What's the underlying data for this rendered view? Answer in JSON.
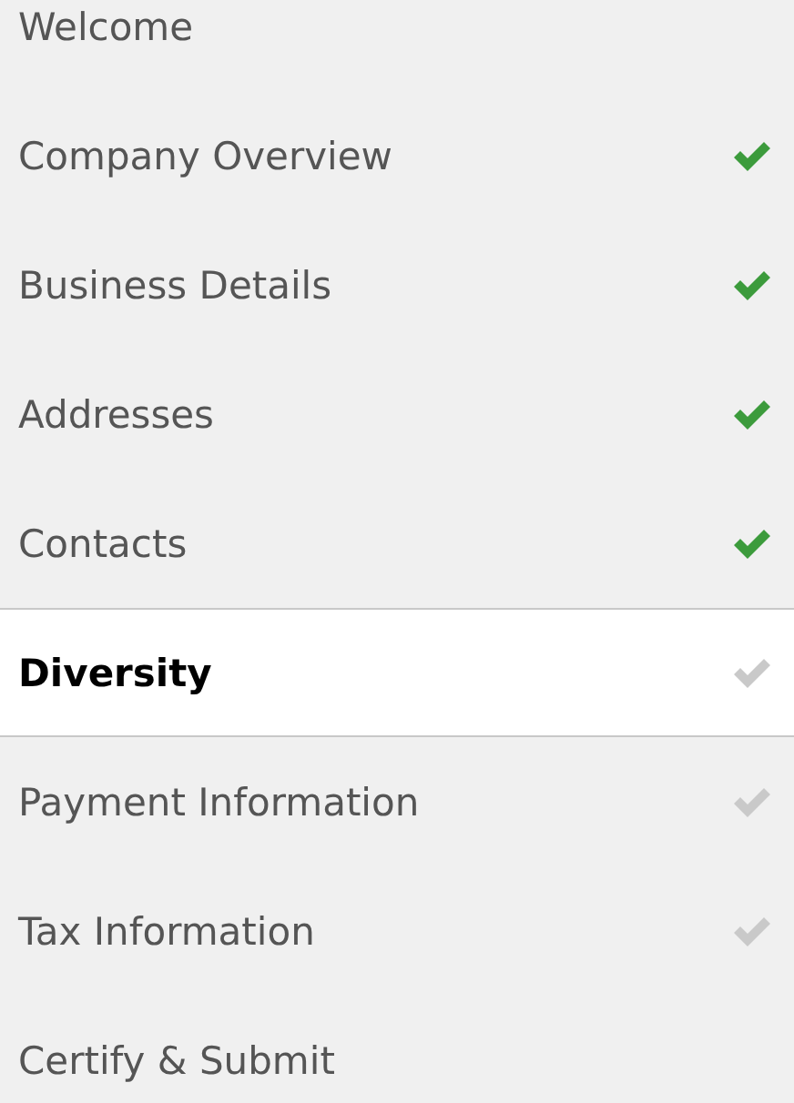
{
  "steps": [
    {
      "label": "Welcome",
      "selected": false
    },
    {
      "label": "Company Overview",
      "selected": false,
      "completed": true
    },
    {
      "label": "Business Details",
      "selected": false,
      "completed": true
    },
    {
      "label": "Addresses",
      "selected": false,
      "completed": true
    },
    {
      "label": "Contacts",
      "selected": false,
      "completed": true
    },
    {
      "label": "Diversity",
      "selected": true,
      "completed": false
    },
    {
      "label": "Payment Information",
      "selected": false,
      "completed": false
    },
    {
      "label": "Tax Information",
      "selected": false,
      "completed": false
    },
    {
      "label": "Certify & Submit",
      "selected": false
    }
  ]
}
